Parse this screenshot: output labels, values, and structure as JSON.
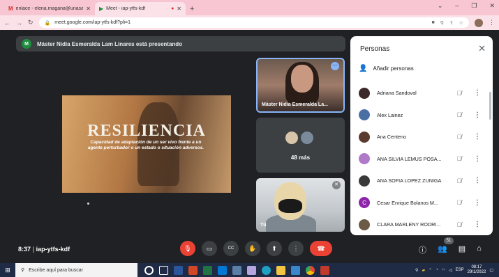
{
  "browser": {
    "tabs": [
      {
        "title": "enlace - elena.magana@unasa.e",
        "icon": "gmail-icon",
        "active": false
      },
      {
        "title": "Meet - iap-ytfs-kdf",
        "icon": "meet-icon",
        "active": true
      }
    ],
    "url": "meet.google.com/iap-ytfs-kdf?pli=1"
  },
  "meet": {
    "presenter_initial": "M",
    "presenting_banner": "Máster Nidia Esmeralda Lam Linares está presentando",
    "slide": {
      "title": "RESILIENCIA",
      "subtitle": "Capacidad de adaptación de un ser vivo frente a un agente perturbador o un estado o situación adversos."
    },
    "tiles": {
      "presenter_name": "Máster Nidia Esmeralda La...",
      "more_label": "48 más",
      "self_label": "Tú"
    },
    "time": "8:37",
    "meeting_code": "iap-ytfs-kdf",
    "participant_count": "51"
  },
  "people_panel": {
    "title": "Personas",
    "add_people": "Añadir personas",
    "participants": [
      {
        "name": "Adriana Sandoval",
        "avatar_color": "#3c2a2a",
        "initial": ""
      },
      {
        "name": "Alex Lainez",
        "avatar_color": "#4a6fa5",
        "initial": ""
      },
      {
        "name": "Ana Centeno",
        "avatar_color": "#5a3b2e",
        "initial": ""
      },
      {
        "name": "ANA SILVIA LEMUS POSA...",
        "avatar_color": "#b07ac9",
        "initial": ""
      },
      {
        "name": "ANA SOFIA LOPEZ ZUNIGA",
        "avatar_color": "#3a3a3a",
        "initial": ""
      },
      {
        "name": "Cesar Enrique Bolanos M...",
        "avatar_color": "#8e24aa",
        "initial": "C"
      },
      {
        "name": "CLARA MARLENY RODRI...",
        "avatar_color": "#6b5a45",
        "initial": ""
      }
    ]
  },
  "taskbar": {
    "search_placeholder": "Escribe aquí para buscar",
    "language": "ESP",
    "clock_time": "08:17",
    "clock_date": "29/1/2022"
  }
}
